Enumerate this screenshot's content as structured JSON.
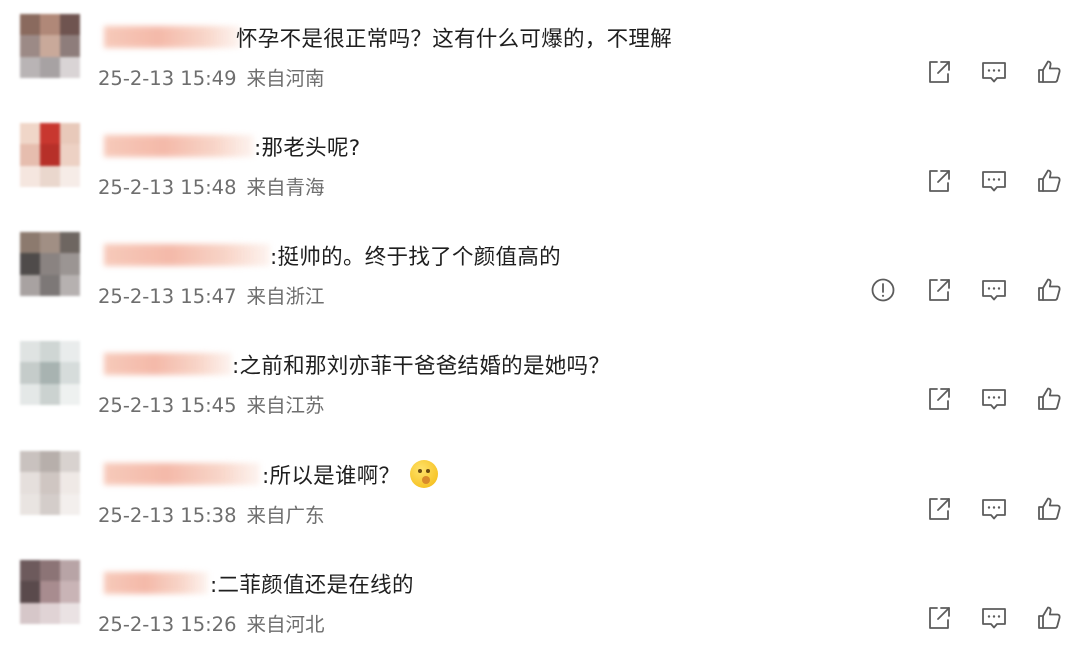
{
  "comments": [
    {
      "text": "怀孕不是很正常吗？这有什么可爆的，不理解",
      "time": "25-2-13 15:49",
      "location": "来自河南",
      "report": false,
      "emoji": null,
      "avatar_colors": [
        "#8a6a5e",
        "#b08878",
        "#6f5450",
        "#9c8a86",
        "#c9a99a",
        "#8e7d7b",
        "#b9b4b5",
        "#a7a2a3",
        "#d9d4d5"
      ]
    },
    {
      "text": ":那老头呢?",
      "time": "25-2-13 15:48",
      "location": "来自青海",
      "report": false,
      "emoji": null,
      "avatar_colors": [
        "#f0d6c8",
        "#c8372f",
        "#e8c9ba",
        "#e6bdae",
        "#b73029",
        "#edd1c4",
        "#f5e6df",
        "#ead7cd",
        "#f6ece7"
      ]
    },
    {
      "text": ":挺帅的。终于找了个颜值高的",
      "time": "25-2-13 15:47",
      "location": "来自浙江",
      "report": true,
      "emoji": null,
      "avatar_colors": [
        "#8c7a6e",
        "#a18f84",
        "#6e6661",
        "#4f4b4a",
        "#8a8381",
        "#9b9593",
        "#a8a2a1",
        "#7d7877",
        "#b6b1b0"
      ]
    },
    {
      "text": ":之前和那刘亦菲干爸爸结婚的是她吗？",
      "time": "25-2-13 15:45",
      "location": "来自江苏",
      "report": false,
      "emoji": null,
      "avatar_colors": [
        "#dfe3e2",
        "#cfd6d4",
        "#e9ecec",
        "#c5ccca",
        "#a8b3b1",
        "#d6dcdb",
        "#e4e8e7",
        "#cbd2d0",
        "#eef1f0"
      ]
    },
    {
      "text": ":所以是谁啊？",
      "time": "25-2-13 15:38",
      "location": "来自广东",
      "report": false,
      "emoji": "shushing-face-emoji",
      "avatar_colors": [
        "#c9c2bf",
        "#b7afab",
        "#d8d2cf",
        "#e5dfdc",
        "#cfc6c2",
        "#efe9e6",
        "#e9e4e1",
        "#d4cdca",
        "#f3efed"
      ]
    },
    {
      "text": ":二菲颜值还是在线的",
      "time": "25-2-13 15:26",
      "location": "来自河北",
      "report": false,
      "emoji": null,
      "avatar_colors": [
        "#6d5a5c",
        "#8c7476",
        "#b8a4a6",
        "#5a4a4c",
        "#a88c8f",
        "#c9b4b6",
        "#d6c7c9",
        "#e0d3d5",
        "#eae2e3"
      ]
    }
  ],
  "actions": {
    "report_icon": "exclamation-circle-icon",
    "share_icon": "share-icon",
    "reply_icon": "comment-icon",
    "like_icon": "thumbs-up-icon"
  }
}
